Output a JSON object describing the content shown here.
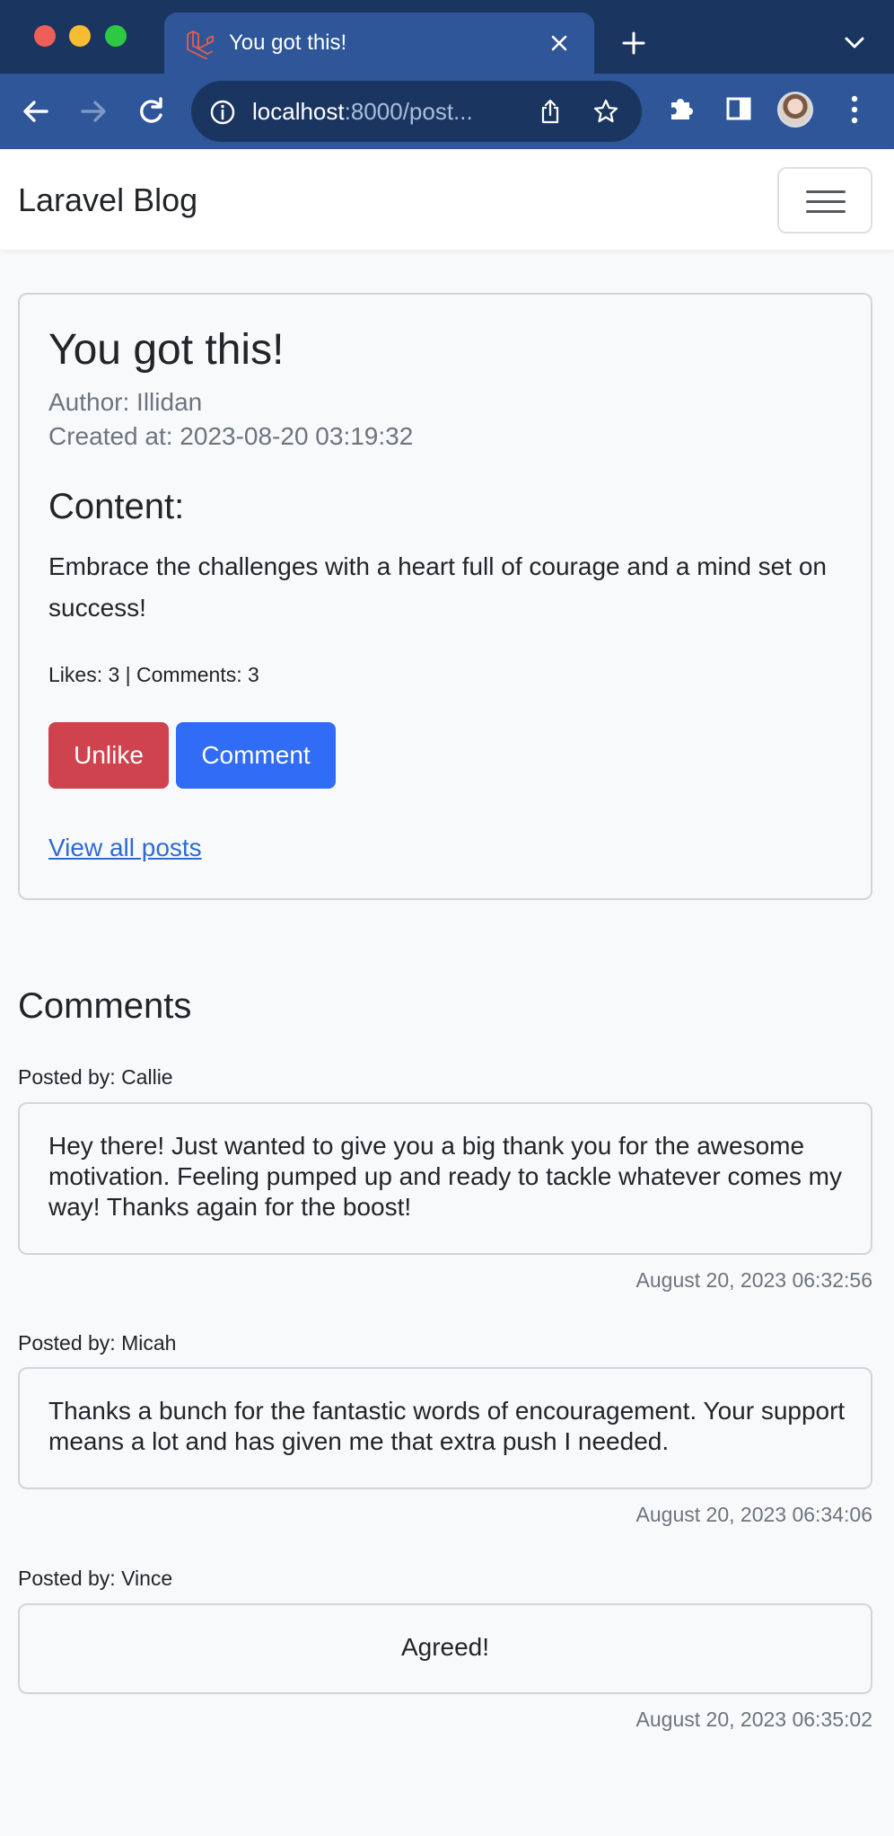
{
  "browser": {
    "tab_title": "You got this!",
    "url_host": "localhost",
    "url_rest": ":8000/post..."
  },
  "navbar": {
    "brand": "Laravel Blog"
  },
  "post": {
    "title": "You got this!",
    "author": "Author: Illidan",
    "created": "Created at: 2023-08-20 03:19:32",
    "content_heading": "Content:",
    "content": "Embrace the challenges with a heart full of courage and a mind set on success!",
    "stats": "Likes: 3 | Comments: 3",
    "unlike_label": "Unlike",
    "comment_label": "Comment",
    "view_all": "View all posts"
  },
  "comments_section": {
    "heading": "Comments",
    "items": [
      {
        "posted_by": "Posted by: Callie",
        "text": "Hey there! Just wanted to give you a big thank you for the awesome motivation. Feeling pumped up and ready to tackle whatever comes my way! Thanks again for the boost!",
        "date": "August 20, 2023 06:32:56"
      },
      {
        "posted_by": "Posted by: Micah",
        "text": "Thanks a bunch for the fantastic words of encouragement. Your support means a lot and has given me that extra push I needed.",
        "date": "August 20, 2023 06:34:06"
      },
      {
        "posted_by": "Posted by: Vince",
        "text": "Agreed!",
        "date": "August 20, 2023 06:35:02"
      }
    ]
  },
  "colors": {
    "chrome_dark": "#1b3561",
    "chrome_tab": "#2e5699",
    "danger": "#ce434d",
    "primary": "#306cf6",
    "link": "#2c6bd6"
  },
  "icons": [
    "laravel-icon",
    "close-icon",
    "plus-icon",
    "chevron-down-icon",
    "back-arrow-icon",
    "forward-arrow-icon",
    "reload-icon",
    "info-icon",
    "share-icon",
    "star-icon",
    "puzzle-icon",
    "side-panel-icon",
    "more-vert-icon",
    "hamburger-icon"
  ]
}
